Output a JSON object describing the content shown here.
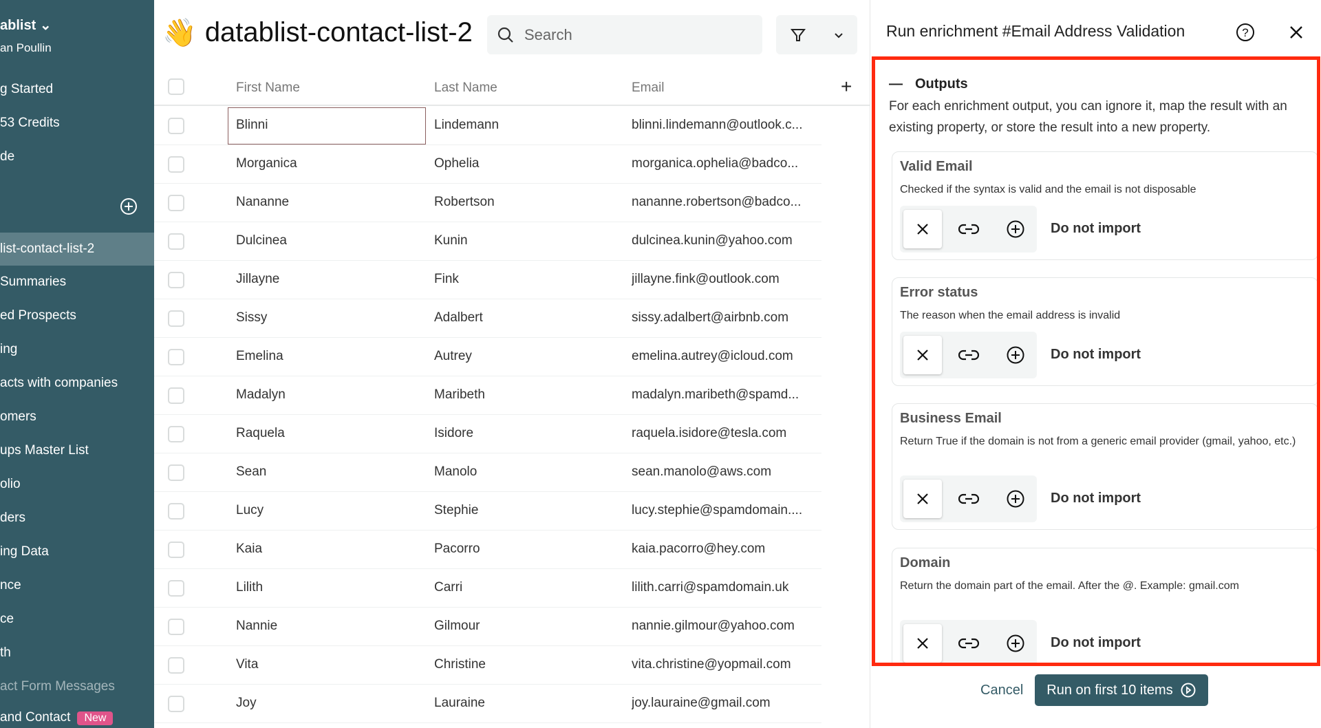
{
  "sidebar": {
    "workspace": "ablist",
    "user": "an Poullin",
    "items": [
      "g Started",
      "53 Credits",
      "de"
    ],
    "lists": [
      "list-contact-list-2",
      "Summaries",
      "ed Prospects",
      "ing",
      "acts with companies",
      "omers",
      "ups Master List",
      "olio",
      "ders",
      "ing Data",
      "nce",
      "ce",
      "th",
      "act Form Messages",
      "and Contact"
    ],
    "new_badge": "New"
  },
  "header": {
    "emoji": "👋",
    "title": "datablist-contact-list-2",
    "search_placeholder": "Search"
  },
  "table": {
    "columns": [
      "First Name",
      "Last Name",
      "Email"
    ],
    "rows": [
      [
        "Blinni",
        "Lindemann",
        "blinni.lindemann@outlook.c..."
      ],
      [
        "Morganica",
        "Ophelia",
        "morganica.ophelia@badco..."
      ],
      [
        "Nananne",
        "Robertson",
        "nananne.robertson@badco..."
      ],
      [
        "Dulcinea",
        "Kunin",
        "dulcinea.kunin@yahoo.com"
      ],
      [
        "Jillayne",
        "Fink",
        "jillayne.fink@outlook.com"
      ],
      [
        "Sissy",
        "Adalbert",
        "sissy.adalbert@airbnb.com"
      ],
      [
        "Emelina",
        "Autrey",
        "emelina.autrey@icloud.com"
      ],
      [
        "Madalyn",
        "Maribeth",
        "madalyn.maribeth@spamd..."
      ],
      [
        "Raquela",
        "Isidore",
        "raquela.isidore@tesla.com"
      ],
      [
        "Sean",
        "Manolo",
        "sean.manolo@aws.com"
      ],
      [
        "Lucy",
        "Stephie",
        "lucy.stephie@spamdomain...."
      ],
      [
        "Kaia",
        "Pacorro",
        "kaia.pacorro@hey.com"
      ],
      [
        "Lilith",
        "Carri",
        "lilith.carri@spamdomain.uk"
      ],
      [
        "Nannie",
        "Gilmour",
        "nannie.gilmour@yahoo.com"
      ],
      [
        "Vita",
        "Christine",
        "vita.christine@yopmail.com"
      ],
      [
        "Joy",
        "Lauraine",
        "joy.lauraine@gmail.com"
      ]
    ]
  },
  "panel": {
    "title": "Run enrichment #Email Address Validation",
    "outputs_label": "Outputs",
    "outputs_desc": "For each enrichment output, you can ignore it, map the result with an existing property, or store the result into a new property.",
    "cards": [
      {
        "name": "Valid Email",
        "desc": "Checked if the syntax is valid and the email is not disposable",
        "status": "Do not import"
      },
      {
        "name": "Error status",
        "desc": "The reason when the email address is invalid",
        "status": "Do not import"
      },
      {
        "name": "Business Email",
        "desc": "Return True if the domain is not from a generic email provider (gmail, yahoo, etc.)",
        "status": "Do not import"
      },
      {
        "name": "Domain",
        "desc": "Return the domain part of the email. After the @. Example: gmail.com",
        "status": "Do not import"
      }
    ],
    "cancel": "Cancel",
    "run": "Run on first 10 items"
  },
  "colors": {
    "sidebar": "#345b66",
    "accent": "#345b66",
    "highlight": "#ff2a10",
    "badge": "#e0548a"
  }
}
